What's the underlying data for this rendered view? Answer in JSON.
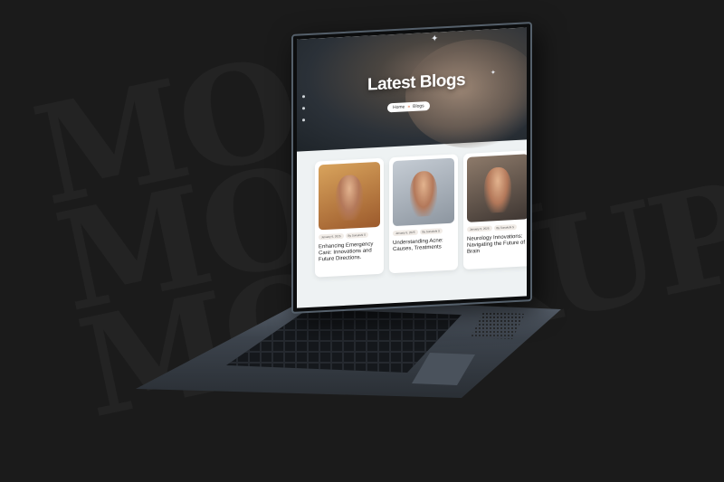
{
  "background_text": [
    "MOC",
    "MOCK",
    "MOCKUP"
  ],
  "website": {
    "hero": {
      "title": "Latest Blogs",
      "breadcrumb": {
        "home": "Home",
        "separator": "»",
        "current": "Blogs"
      }
    },
    "posts": [
      {
        "date": "January 6, 2025",
        "author": "By Sonakshi S",
        "title": "Enhancing Emergency Care: Innovations and Future Directions.",
        "thumb_color": "#c98a4a"
      },
      {
        "date": "January 5, 2025",
        "author": "By Sonakshi S",
        "title": "Understanding Acne: Causes, Treatments",
        "thumb_color": "#a9b2bd"
      },
      {
        "date": "January 5, 2025",
        "author": "By Sonakshi S",
        "title": "Neurology Innovations: Navigating the Future of Brain",
        "thumb_color": "#7b6a5d"
      }
    ]
  },
  "colors": {
    "page_bg": "#1b1b1b",
    "accent": "#e0612f",
    "card_bg": "#ffffff"
  }
}
